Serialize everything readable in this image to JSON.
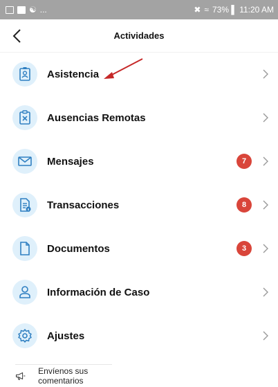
{
  "status_bar": {
    "left_text": "...",
    "right_text": "73% ▌ 11:20 AM"
  },
  "header": {
    "title": "Actividades"
  },
  "menu": {
    "items": [
      {
        "label": "Asistencia",
        "icon": "id-badge-icon",
        "badge": ""
      },
      {
        "label": "Ausencias Remotas",
        "icon": "clipboard-x-icon",
        "badge": ""
      },
      {
        "label": "Mensajes",
        "icon": "envelope-icon",
        "badge": "7"
      },
      {
        "label": "Transacciones",
        "icon": "document-info-icon",
        "badge": "8"
      },
      {
        "label": "Documentos",
        "icon": "file-icon",
        "badge": "3"
      },
      {
        "label": "Información de Caso",
        "icon": "user-icon",
        "badge": ""
      },
      {
        "label": "Ajustes",
        "icon": "gear-icon",
        "badge": ""
      }
    ]
  },
  "feedback": {
    "label": "Envíenos sus comentarios",
    "icon": "megaphone-icon"
  },
  "colors": {
    "icon_bg": "#dff0fb",
    "icon_stroke": "#2f7fc1",
    "badge": "#d9453a",
    "annotation_arrow": "#c62828",
    "status_bar": "#a3a3a3"
  }
}
